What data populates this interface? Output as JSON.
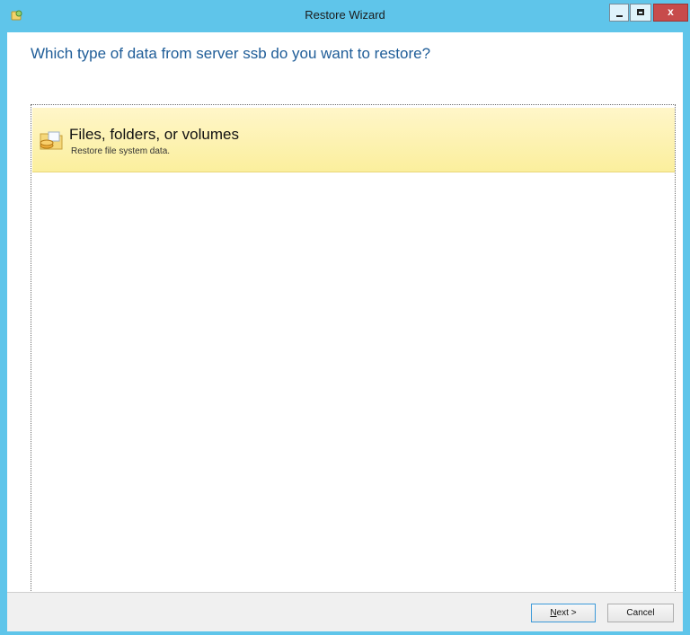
{
  "window": {
    "title": "Restore Wizard",
    "controls": {
      "minimize_glyph": "–",
      "maximize_glyph": "□",
      "close_glyph": "x"
    }
  },
  "page": {
    "heading": "Which type of data from server ssb do you want to restore?"
  },
  "options": [
    {
      "title": "Files, folders, or volumes",
      "subtitle": "Restore file system data.",
      "icon": "folder-database-icon",
      "selected": true
    }
  ],
  "footer": {
    "next_accel": "N",
    "next_rest": "ext >",
    "cancel_label": "Cancel"
  },
  "colors": {
    "titlebar": "#5fc5ea",
    "heading": "#1f5d98",
    "selection": "#fbef9d",
    "close_button": "#c74b4b"
  }
}
